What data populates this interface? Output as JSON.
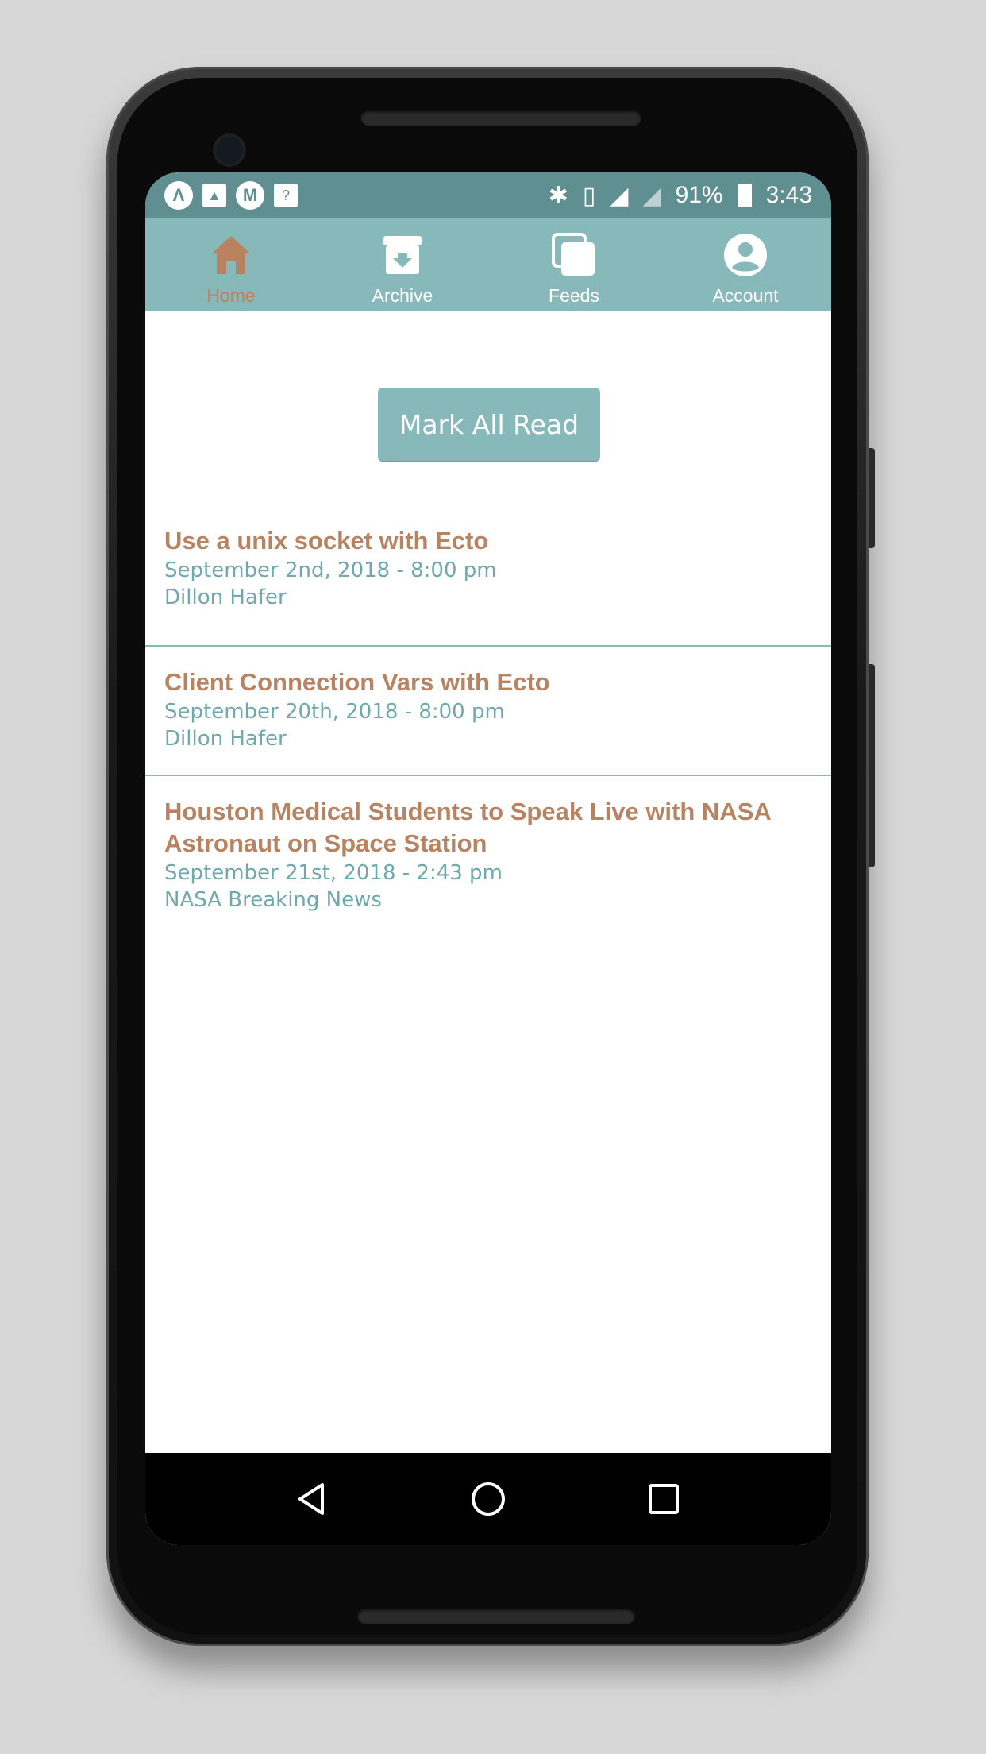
{
  "statusbar": {
    "battery": "91%",
    "time": "3:43"
  },
  "tabs": [
    {
      "label": "Home",
      "icon": "home-icon",
      "active": true
    },
    {
      "label": "Archive",
      "icon": "archive-icon",
      "active": false
    },
    {
      "label": "Feeds",
      "icon": "feeds-icon",
      "active": false
    },
    {
      "label": "Account",
      "icon": "account-icon",
      "active": false
    }
  ],
  "main": {
    "mark_all_read_label": "Mark All Read",
    "articles": [
      {
        "title": "Use a unix socket with Ecto",
        "date": "September 2nd, 2018 - 8:00 pm",
        "author": "Dillon Hafer"
      },
      {
        "title": "Client Connection Vars with Ecto",
        "date": "September 20th, 2018 - 8:00 pm",
        "author": "Dillon Hafer"
      },
      {
        "title": "Houston Medical Students to Speak Live with NASA Astronaut on Space Station",
        "date": "September 21st, 2018 - 2:43 pm",
        "author": "NASA Breaking News"
      }
    ]
  },
  "colors": {
    "accent": "#b98361",
    "teal": "#87b8ba",
    "status_bar": "#5f8f91"
  }
}
